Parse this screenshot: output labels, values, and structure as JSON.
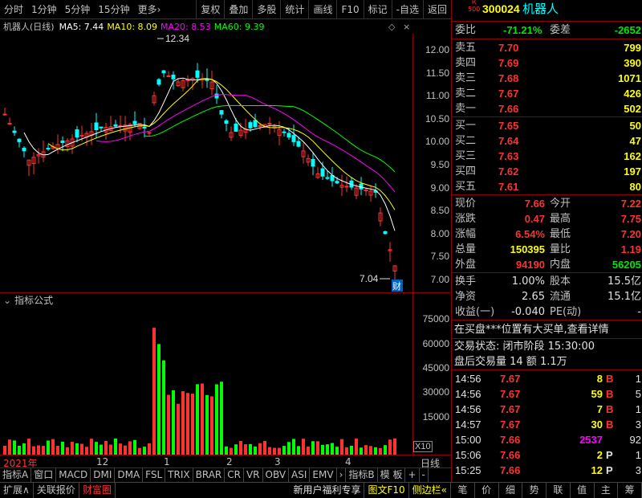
{
  "toolbar": {
    "left": [
      "分时",
      "1分钟",
      "5分钟",
      "15分钟",
      "更多›"
    ],
    "right": [
      "复权",
      "叠加",
      "多股",
      "统计",
      "画线",
      "F10",
      "标记",
      "-自选",
      "返回"
    ]
  },
  "kline_header": {
    "name": "机器人(日线)",
    "ma5": "MA5: 7.44",
    "ma10": "MA10: 8.09",
    "ma20": "MA20: 8.53",
    "ma60": "MA60: 9.39",
    "colors": {
      "ma5": "#ffffff",
      "ma10": "#ffff00",
      "ma20": "#ff00ff",
      "ma60": "#00ff00"
    }
  },
  "price_labels": {
    "high": "12.34",
    "low": "7.04",
    "cai": "财"
  },
  "price_ticks": [
    "12.00",
    "11.50",
    "11.00",
    "10.50",
    "10.00",
    "9.50",
    "9.00",
    "8.50",
    "8.00",
    "7.50",
    "7.00"
  ],
  "indicator_header": {
    "title": "指标公式"
  },
  "volume_ticks": [
    "75000",
    "60000",
    "45000",
    "30000",
    "15000"
  ],
  "volume_unit": "X10",
  "date_labels": [
    "2021年",
    "12",
    "1",
    "2",
    "3",
    "4"
  ],
  "date_axis_right": "日线",
  "indicator_tabs": [
    "指标A",
    "窗口",
    "MACD",
    "DMI",
    "DMA",
    "FSL",
    "TRIX",
    "BRAR",
    "CR",
    "VR",
    "OBV",
    "ASI",
    "EMV",
    "›",
    "指标B",
    "模 板",
    "+",
    "-"
  ],
  "bottom_bar": {
    "left": [
      "扩展∧",
      "关联报价",
      "财富圈"
    ],
    "right": [
      "新用户福利专享",
      "图文F10",
      "侧边栏«"
    ],
    "tabs": [
      "笔",
      "价",
      "细",
      "势",
      "联",
      "值",
      "主",
      "筹"
    ]
  },
  "stock": {
    "code": "300024",
    "name": "机器人",
    "badge_top": "R",
    "badge_bottom": "500"
  },
  "weibi": {
    "label1": "委比",
    "value1": "-71.21%",
    "label2": "委差",
    "value2": "-2652"
  },
  "asks": [
    {
      "label": "卖五",
      "price": "7.70",
      "vol": "799"
    },
    {
      "label": "卖四",
      "price": "7.69",
      "vol": "390"
    },
    {
      "label": "卖三",
      "price": "7.68",
      "vol": "1071"
    },
    {
      "label": "卖二",
      "price": "7.67",
      "vol": "426"
    },
    {
      "label": "卖一",
      "price": "7.66",
      "vol": "502"
    }
  ],
  "bids": [
    {
      "label": "买一",
      "price": "7.65",
      "vol": "50"
    },
    {
      "label": "买二",
      "price": "7.64",
      "vol": "47"
    },
    {
      "label": "买三",
      "price": "7.63",
      "vol": "162"
    },
    {
      "label": "买四",
      "price": "7.62",
      "vol": "197"
    },
    {
      "label": "买五",
      "price": "7.61",
      "vol": "80"
    }
  ],
  "quote": [
    {
      "l1": "现价",
      "v1": "7.66",
      "c1": "red",
      "l2": "今开",
      "v2": "7.22",
      "c2": "red"
    },
    {
      "l1": "涨跌",
      "v1": "0.47",
      "c1": "red",
      "l2": "最高",
      "v2": "7.75",
      "c2": "red"
    },
    {
      "l1": "涨幅",
      "v1": "6.54%",
      "c1": "red",
      "l2": "最低",
      "v2": "7.20",
      "c2": "red"
    },
    {
      "l1": "总量",
      "v1": "150395",
      "c1": "yellow",
      "l2": "量比",
      "v2": "1.19",
      "c2": "red"
    },
    {
      "l1": "外盘",
      "v1": "94190",
      "c1": "red",
      "l2": "内盘",
      "v2": "56205",
      "c2": "green"
    }
  ],
  "fundamentals": [
    {
      "l1": "换手",
      "v1": "1.00%",
      "l2": "股本",
      "v2": "15.5亿"
    },
    {
      "l1": "净资",
      "v1": "2.65",
      "l2": "流通",
      "v2": "15.1亿"
    },
    {
      "l1": "收益(一)",
      "v1": "-0.040",
      "l2": "PE(动)",
      "v2": "-"
    }
  ],
  "notice": "在买盘***位置有大买单,查看详情",
  "trade_status": "交易状态: 闭市阶段 15:30:00",
  "after_hours": "盘后交易量 14 额 1.1万",
  "ticks": [
    {
      "time": "14:56",
      "price": "7.67",
      "vol": "8",
      "vol_color": "yellow",
      "side": "B",
      "n": "1"
    },
    {
      "time": "14:56",
      "price": "7.67",
      "vol": "59",
      "vol_color": "yellow",
      "side": "B",
      "n": "5"
    },
    {
      "time": "14:56",
      "price": "7.67",
      "vol": "7",
      "vol_color": "yellow",
      "side": "B",
      "n": "1"
    },
    {
      "time": "14:57",
      "price": "7.67",
      "vol": "30",
      "vol_color": "yellow",
      "side": "B",
      "n": "3"
    },
    {
      "time": "15:00",
      "price": "7.66",
      "vol": "2537",
      "vol_color": "magenta",
      "side": "",
      "n": "92"
    },
    {
      "time": "15:06",
      "price": "7.66",
      "vol": "2",
      "vol_color": "yellow",
      "side": "P",
      "n": "1"
    },
    {
      "time": "15:25",
      "price": "7.66",
      "vol": "12",
      "vol_color": "yellow",
      "side": "P",
      "n": "3"
    }
  ]
}
